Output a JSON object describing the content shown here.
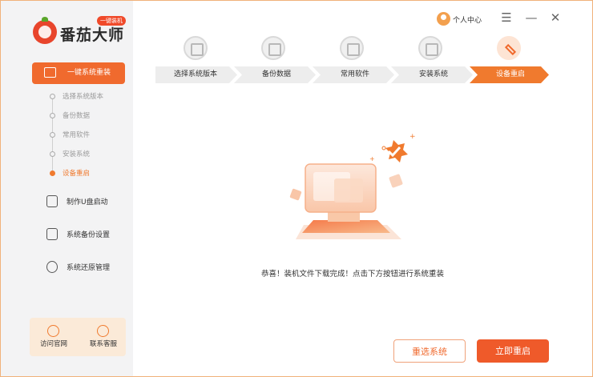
{
  "app": {
    "name": "番茄大师",
    "badge": "一键装机"
  },
  "sidebar": {
    "active_item": {
      "label": "一键系统重装",
      "icon": "monitor-icon"
    },
    "steps": [
      {
        "label": "选择系统版本",
        "current": false
      },
      {
        "label": "备份数据",
        "current": false
      },
      {
        "label": "常用软件",
        "current": false
      },
      {
        "label": "安装系统",
        "current": false
      },
      {
        "label": "设备重启",
        "current": true
      }
    ],
    "items": [
      {
        "label": "制作U盘启动",
        "icon": "usb-drive-icon"
      },
      {
        "label": "系统备份设置",
        "icon": "backup-icon"
      },
      {
        "label": "系统还原管理",
        "icon": "restore-icon"
      }
    ],
    "footer": [
      {
        "label": "访问官网",
        "icon": "browser-icon"
      },
      {
        "label": "联系客服",
        "icon": "headset-icon"
      }
    ]
  },
  "topbar": {
    "user_label": "个人中心",
    "menu_glyph": "☰",
    "minimize_glyph": "—",
    "close_glyph": "✕"
  },
  "progress": {
    "steps": [
      {
        "label": "选择系统版本",
        "icon": "layers-icon",
        "current": false
      },
      {
        "label": "备份数据",
        "icon": "backup-data-icon",
        "current": false
      },
      {
        "label": "常用软件",
        "icon": "apps-icon",
        "current": false
      },
      {
        "label": "安装系统",
        "icon": "download-icon",
        "current": false
      },
      {
        "label": "设备重启",
        "icon": "tools-icon",
        "current": true
      }
    ]
  },
  "main": {
    "message": "恭喜！装机文件下载完成！点击下方按钮进行系统重装",
    "buttons": {
      "reselect": "重选系统",
      "restart_now": "立即重启"
    }
  },
  "colors": {
    "accent": "#f06a2e",
    "accent_dark": "#ef5a2a",
    "step_done": "#ededed"
  }
}
